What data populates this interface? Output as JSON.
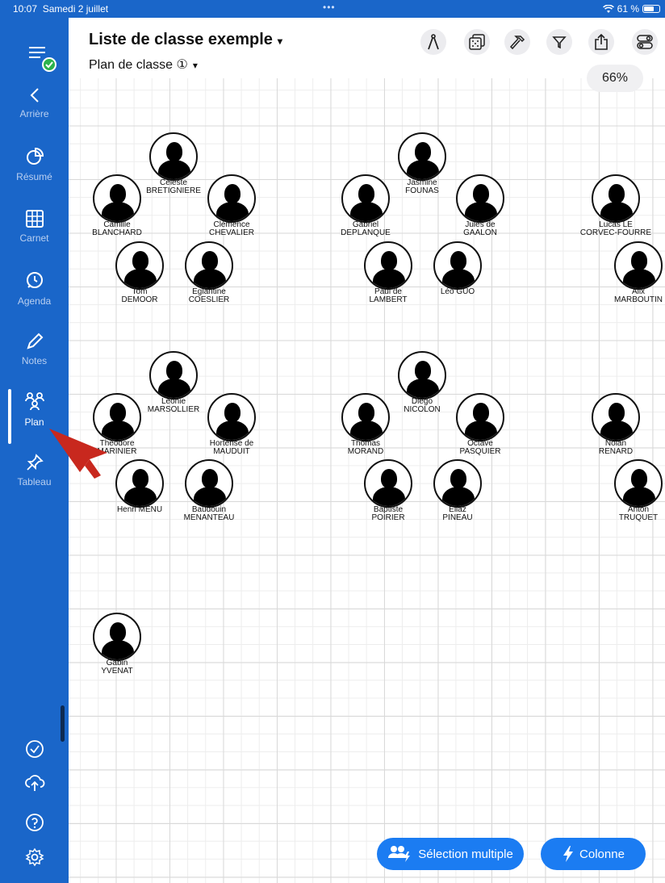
{
  "status": {
    "time": "10:07",
    "date": "Samedi 2 juillet",
    "dots": "•••",
    "battery": "61 %"
  },
  "sidebar": {
    "arriere": "Arrière",
    "items": [
      {
        "label": "Résumé",
        "icon": "pie-chart-icon"
      },
      {
        "label": "Carnet",
        "icon": "grid-icon"
      },
      {
        "label": "Agenda",
        "icon": "clock-icon"
      },
      {
        "label": "Notes",
        "icon": "pencil-icon"
      },
      {
        "label": "Plan",
        "icon": "people-icon"
      },
      {
        "label": "Tableau",
        "icon": "pin-icon"
      }
    ]
  },
  "header": {
    "title": "Liste de classe exemple",
    "title_caret": "▾",
    "subtitle": "Plan de classe ①",
    "subtitle_caret": "▾",
    "zoom": "66%"
  },
  "students": [
    {
      "first": "Céleste",
      "last": "BRETIGNIERE"
    },
    {
      "first": "Camille",
      "last": "BLANCHARD"
    },
    {
      "first": "Clémence",
      "last": "CHEVALIER"
    },
    {
      "first": "Tom",
      "last": "DEMOOR"
    },
    {
      "first": "Eglantine",
      "last": "COESLIER"
    },
    {
      "first": "Jasmine",
      "last": "FOUNAS"
    },
    {
      "first": "Gabriel",
      "last": "DEPLANQUE"
    },
    {
      "first": "Jules de",
      "last": "GAALON"
    },
    {
      "first": "Paul de",
      "last": "LAMBERT"
    },
    {
      "first": "",
      "last": "Léo GUO"
    },
    {
      "first": "Lucas LE",
      "last": "CORVEC-FOURRE"
    },
    {
      "first": "Alix",
      "last": "MARBOUTIN"
    },
    {
      "first": "Léonie",
      "last": "MARSOLLIER"
    },
    {
      "first": "Théodore",
      "last": "MARINIER"
    },
    {
      "first": "Hortense de",
      "last": "MAUDUIT"
    },
    {
      "first": "",
      "last": "Henri MENU"
    },
    {
      "first": "Baudouin",
      "last": "MENANTEAU"
    },
    {
      "first": "Diégo",
      "last": "NICOLON"
    },
    {
      "first": "Thomas",
      "last": "MORAND"
    },
    {
      "first": "Octave",
      "last": "PASQUIER"
    },
    {
      "first": "Baptiste",
      "last": "POIRIER"
    },
    {
      "first": "Eliaz",
      "last": "PINEAU"
    },
    {
      "first": "Nolan",
      "last": "RENARD"
    },
    {
      "first": "Anton",
      "last": "TRUQUET"
    },
    {
      "first": "Gabin",
      "last": "YVENAT"
    }
  ],
  "actions": {
    "multi_select": "Sélection multiple",
    "column": "Colonne"
  },
  "colors": {
    "brand": "#1a66c9",
    "accent": "#1b7cf2",
    "pointer": "#c8281e",
    "status_ok": "#2bb24c"
  }
}
